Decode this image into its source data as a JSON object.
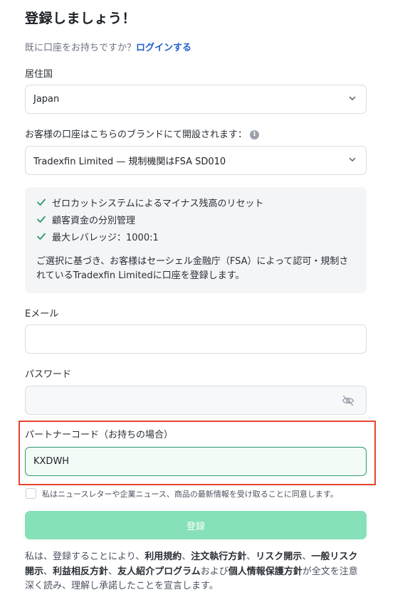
{
  "title": "登録しましょう！",
  "login_prompt": "既に口座をお持ちですか？",
  "login_link": "ログインする",
  "residence": {
    "label": "居住国",
    "value": "Japan"
  },
  "brand": {
    "label": "お客様の口座はこちらのブランドにて開設されます：",
    "value": "Tradexfin Limited — 規制機関はFSA SD010"
  },
  "features": [
    "ゼロカットシステムによるマイナス残高のリセット",
    "顧客資金の分別管理",
    "最大レバレッジ：1000:1"
  ],
  "panel_note": "ご選択に基づき、お客様はセーシェル金融庁（FSA）によって認可・規制されているTradexfin Limitedに口座を登録します。",
  "email": {
    "label": "Eメール",
    "value": ""
  },
  "password": {
    "label": "パスワード",
    "value": ""
  },
  "partner_code": {
    "label": "パートナーコード（お持ちの場合）",
    "value": "KXDWH"
  },
  "consent_text": "私はニュースレターや企業ニュース、商品の最新情報を受け取ることに同意します。",
  "submit_label": "登録",
  "terms": {
    "p1": "私は、登録することにより、",
    "l1": "利用規約",
    "s1": "、",
    "l2": "注文執行方針",
    "s2": "、",
    "l3": "リスク開示",
    "s3": "、",
    "l4": "一般リスク開示",
    "s4": "、",
    "l5": "利益相反方針",
    "s5": "、",
    "l6": "友人紹介プログラム",
    "p2": "および",
    "l7": "個人情報保護方針",
    "p3": "が全文を注意深く読み、理解し承諾したことを宣言します。"
  },
  "colors": {
    "accent_green": "#2a9a6a",
    "button_green": "#86e0b8",
    "link_blue": "#1e5fd0",
    "highlight_red": "#e8432d"
  }
}
